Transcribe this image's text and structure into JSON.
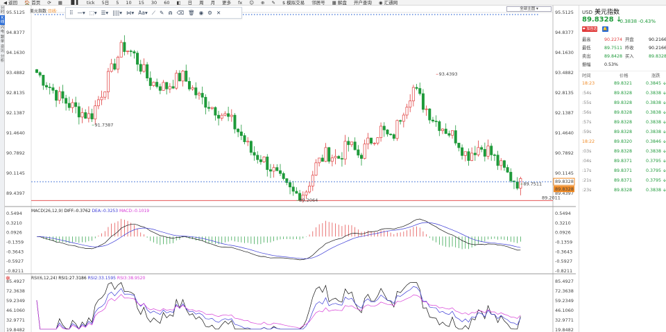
{
  "toolbar": {
    "items": [
      "◀ 返回",
      "🏠 首页",
      "⟳",
      "▦",
      "▐▌▌",
      "tick",
      "5日",
      "5",
      "10",
      "15",
      "30",
      "60",
      "◧",
      "日",
      "周",
      "月",
      "更多",
      "fx",
      "☺",
      "⊕",
      "✎",
      "$ 模拟交易",
      "邻居号",
      "▦ 解盘",
      "开户查询",
      "◉ 汇通网"
    ]
  },
  "left_tabs": [
    "分时",
    "K线",
    "闪电",
    "跟单",
    "资讯",
    "分析"
  ],
  "chart": {
    "symbol_tag": "美元指数",
    "period_tag": "·日线·",
    "period_select": "全部主图 ▾",
    "draw_tools": [
      "⠿",
      "—▾",
      "⬚▾",
      "☰▾",
      "||||▾",
      "⋈▾",
      "Aa▾",
      "⟋",
      "✎",
      "⋒",
      "⌫",
      "🗑",
      "◉",
      "⚙",
      "✕"
    ],
    "price_ticks": [
      "95.5125",
      "94.8377",
      "94.1630",
      "93.4882",
      "92.8135",
      "92.1387",
      "91.4640",
      "90.7892",
      "90.1145",
      "89.4397"
    ],
    "price_annotations": {
      "low1": "91.7387",
      "high": "93.4393",
      "low_main": "89.2064",
      "last": "89.7511"
    },
    "current_price_tag": "89.8328",
    "support_tag": "89.2011",
    "second_tag": "89.4397",
    "macd": {
      "title": "MACD(26,12,9)",
      "diff": "DIFF:-0.3762",
      "dea": "DEA:-0.3253",
      "macd": "MACD:-0.1019",
      "ticks": [
        "0.5494",
        "0.3210",
        "0.0926",
        "-0.1359",
        "-0.3643",
        "-0.5927",
        "-0.8211"
      ]
    },
    "rsi": {
      "title": "RSI(6,12,24)",
      "rsi1": "RSI1:27.3186",
      "rsi2": "RSI2:33.1595",
      "rsi3": "RSI3:38.9520",
      "star": "✻",
      "ticks": [
        "85.4927",
        "72.3638",
        "59.2349",
        "46.1060",
        "32.9771",
        "19.8482"
      ]
    },
    "colors": {
      "up": "#e03b3b",
      "down": "#1e9a3a",
      "diff": "#111111",
      "dea": "#3a3ad6",
      "rsi3": "#d63ad6"
    }
  },
  "quote": {
    "currency": "USD",
    "name": "美元指数",
    "price": "89.8328 ↓",
    "change": "-0.3838  -0.43%",
    "badge_follow": "❤ 加自选",
    "badge_alert": "🔔",
    "rows": [
      {
        "l1": "最高",
        "v1": "90.2274",
        "c1": "red",
        "l2": "开盘",
        "v2": "90.2166",
        "c2": "dark"
      },
      {
        "l1": "最低",
        "v1": "89.7511",
        "c1": "green",
        "l2": "昨收",
        "v2": "90.2166",
        "c2": "dark"
      },
      {
        "l1": "卖出",
        "v1": "89.8428",
        "c1": "green",
        "l2": "买入",
        "v2": "89.8328",
        "c2": "green"
      },
      {
        "l1": "振幅",
        "v1": "0.53%",
        "c1": "dark",
        "l2": "",
        "v2": "",
        "c2": "dark"
      }
    ],
    "tick_head": {
      "time": "时间",
      "price": "价格",
      "change": "涨跌"
    },
    "ticks": [
      {
        "time": "18:23",
        "price": "89.8321",
        "change": "0.3845",
        "arrow": "🡫",
        "time_orange": true
      },
      {
        "time": ":54s",
        "price": "89.8328",
        "change": "0.3838",
        "arrow": "🡫",
        "time_orange": false
      },
      {
        "time": ":55s",
        "price": "89.8328",
        "change": "0.3838",
        "arrow": "🡫",
        "time_orange": false
      },
      {
        "time": ":56s",
        "price": "89.8328",
        "change": "0.3838",
        "arrow": "🡫",
        "time_orange": false
      },
      {
        "time": ":57s",
        "price": "89.8328",
        "change": "0.3838",
        "arrow": "🡫",
        "time_orange": false
      },
      {
        "time": ":59s",
        "price": "89.8328",
        "change": "0.3838",
        "arrow": "🡫",
        "time_orange": false
      },
      {
        "time": "18:22",
        "price": "89.8320",
        "change": "0.3846",
        "arrow": "🡫",
        "time_orange": true
      },
      {
        "time": ":03s",
        "price": "89.8328",
        "change": "0.3838",
        "arrow": "🡫",
        "time_orange": false
      },
      {
        "time": ":04s",
        "price": "89.8371",
        "change": "0.3795",
        "arrow": "🡫",
        "time_orange": false
      },
      {
        "time": ":17s",
        "price": "89.8371",
        "change": "0.3795",
        "arrow": "🡫",
        "time_orange": false
      },
      {
        "time": ":21s",
        "price": "89.8371",
        "change": "0.3795",
        "arrow": "🡫",
        "time_orange": false
      },
      {
        "time": ":23s",
        "price": "89.8328",
        "change": "0.3838",
        "arrow": "🡫",
        "time_orange": false
      }
    ]
  }
}
